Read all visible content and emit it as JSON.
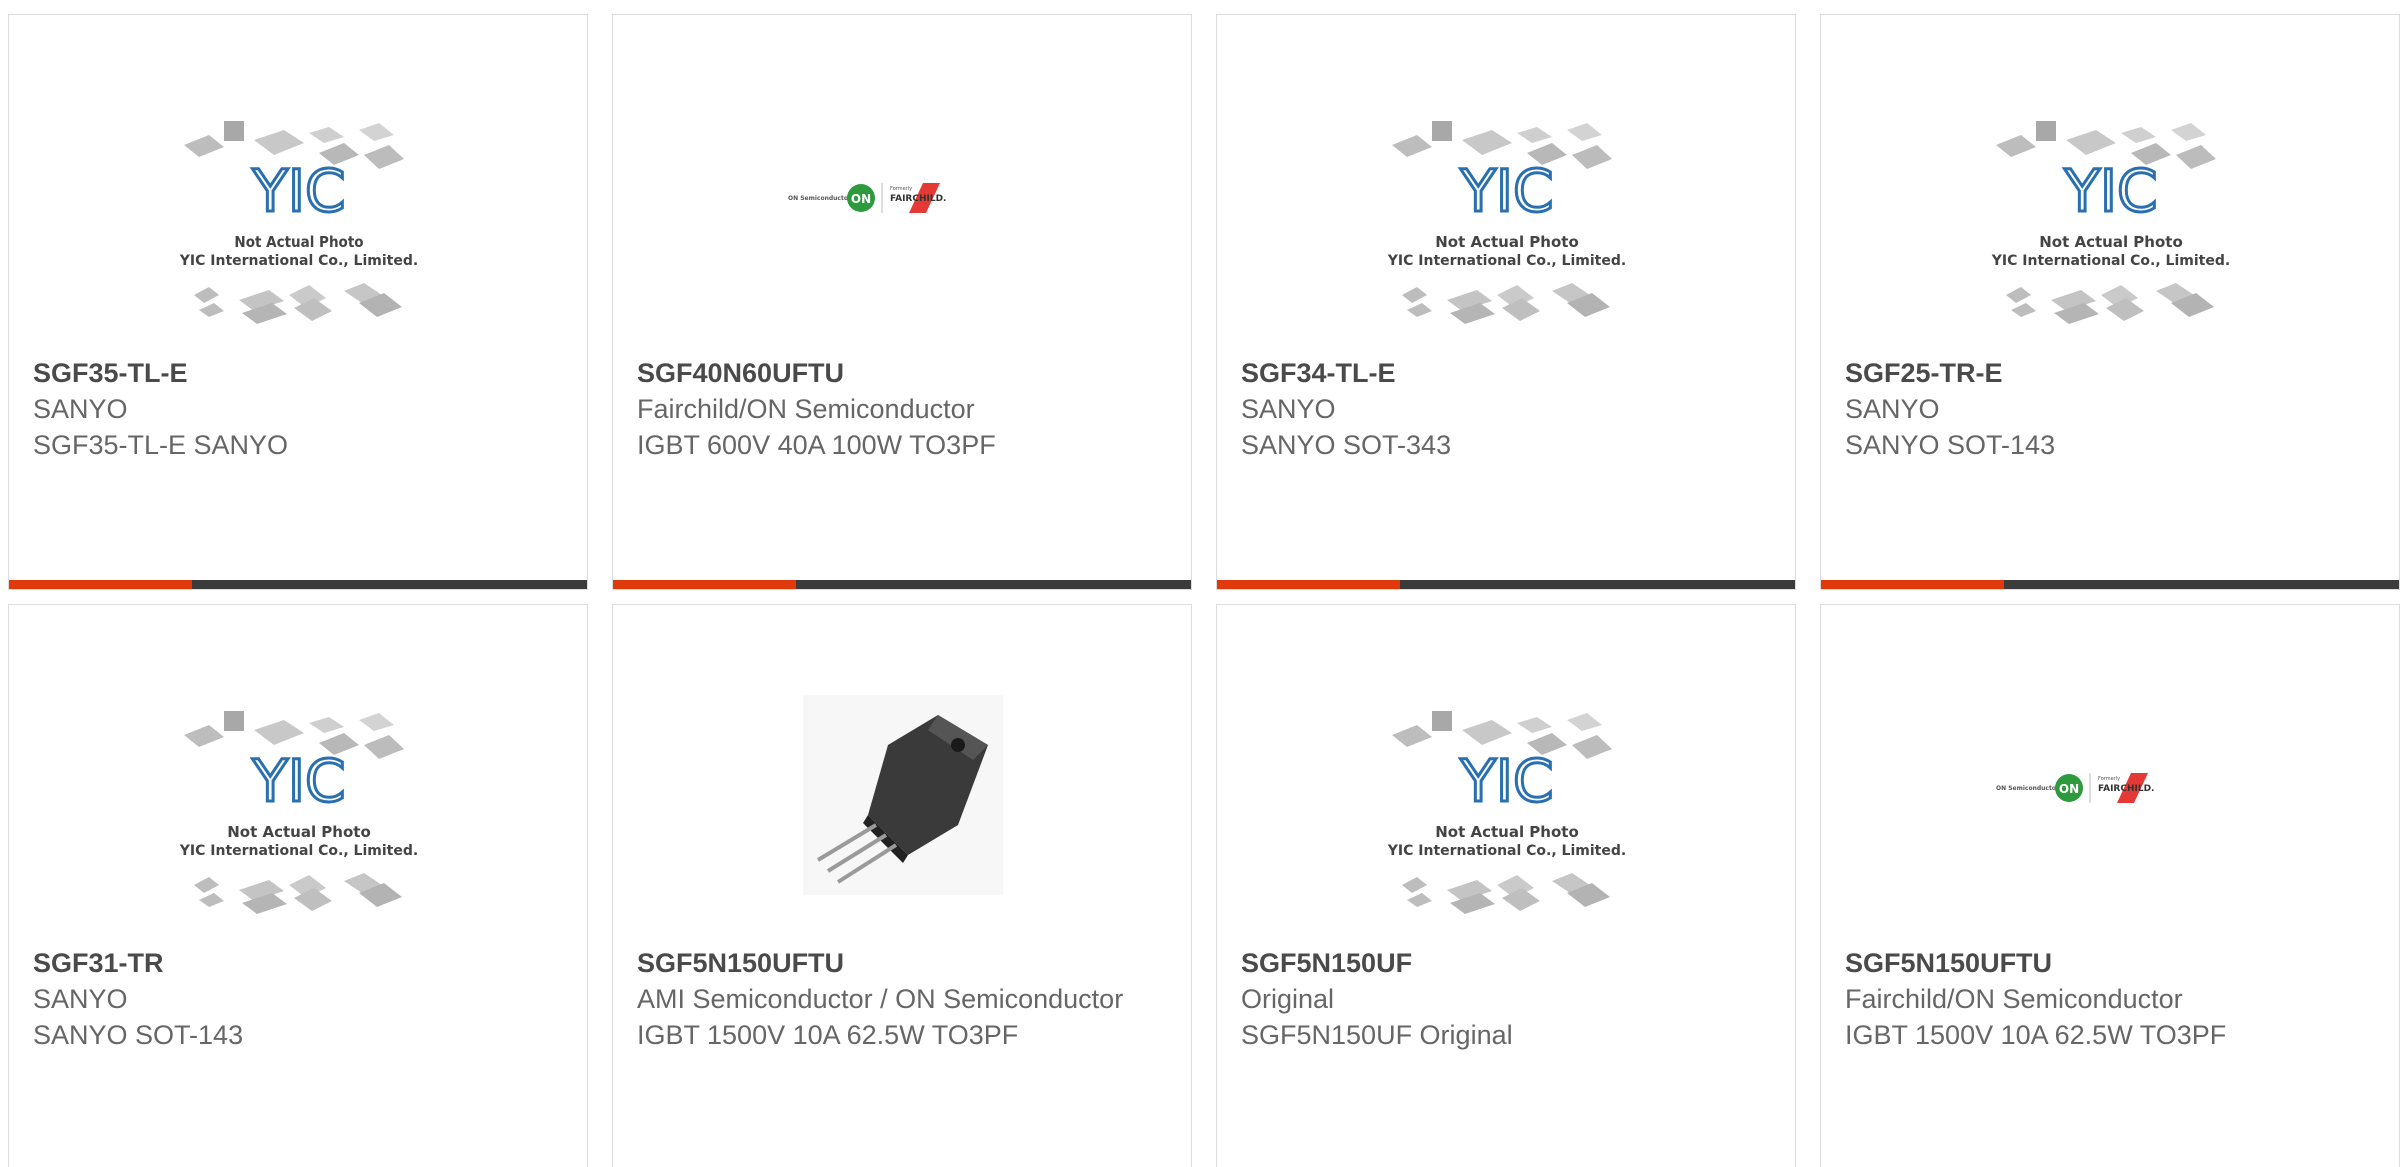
{
  "products": [
    {
      "part": "SGF35-TL-E",
      "manufacturer": "SANYO",
      "description": "SGF35-TL-E SANYO",
      "image": "yic-placeholder"
    },
    {
      "part": "SGF40N60UFTU",
      "manufacturer": "Fairchild/ON Semiconductor",
      "description": "IGBT 600V 40A 100W TO3PF",
      "image": "on-fairchild-logo"
    },
    {
      "part": "SGF34-TL-E",
      "manufacturer": "SANYO",
      "description": "SANYO SOT-343",
      "image": "yic-placeholder"
    },
    {
      "part": "SGF25-TR-E",
      "manufacturer": "SANYO",
      "description": "SANYO SOT-143",
      "image": "yic-placeholder"
    },
    {
      "part": "SGF31-TR",
      "manufacturer": "SANYO",
      "description": "SANYO SOT-143",
      "image": "yic-placeholder"
    },
    {
      "part": "SGF5N150UFTU",
      "manufacturer": "AMI Semiconductor / ON Semiconductor",
      "description": "IGBT 1500V 10A 62.5W TO3PF",
      "image": "to3pf-transistor-photo"
    },
    {
      "part": "SGF5N150UF",
      "manufacturer": "Original",
      "description": "SGF5N150UF Original",
      "image": "yic-placeholder"
    },
    {
      "part": "SGF5N150UFTU",
      "manufacturer": "Fairchild/ON Semiconductor",
      "description": "IGBT 1500V 10A 62.5W TO3PF",
      "image": "on-fairchild-logo"
    }
  ],
  "placeholder": {
    "line1": "Not Actual Photo",
    "line2": "YIC International Co., Limited."
  },
  "logo": {
    "on_text": "ON Semiconductor",
    "on_badge": "ON",
    "formerly": "Formerly",
    "fairchild": "FAIRCHILD."
  },
  "colors": {
    "accent": "#e03a0c",
    "bar": "#3b3b3b",
    "yic_blue": "#2a6fb0"
  }
}
